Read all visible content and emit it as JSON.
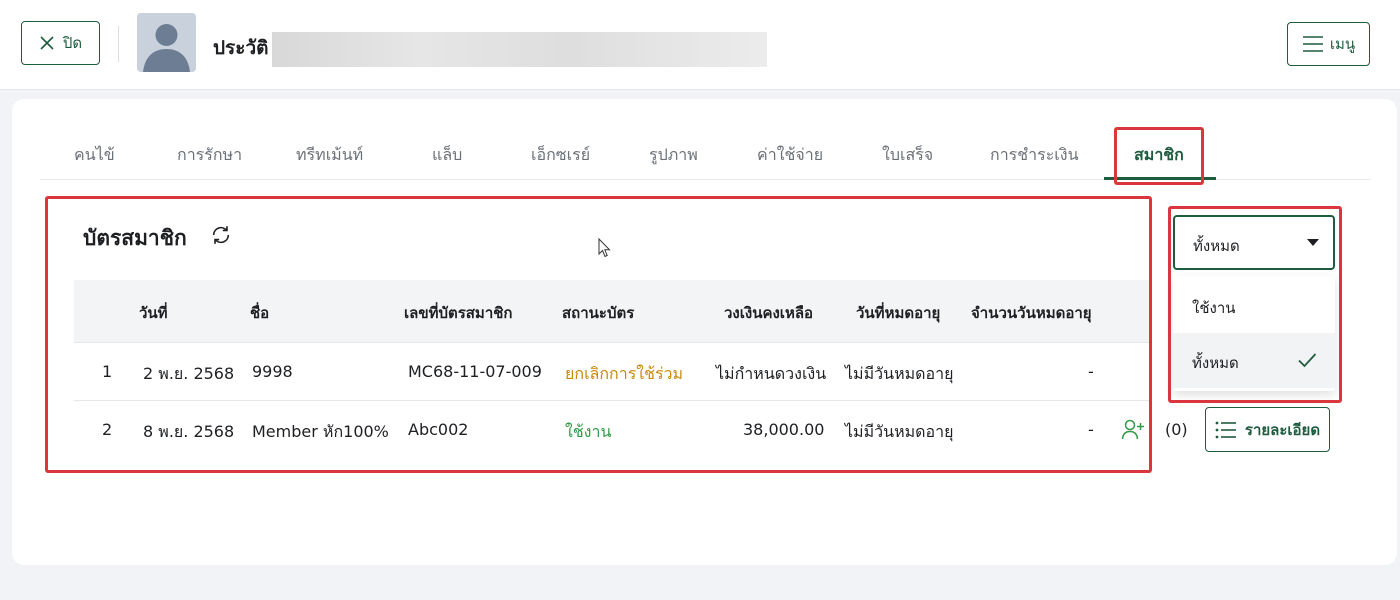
{
  "header": {
    "close_label": "ปิด",
    "title": "ประวัติ",
    "menu_label": "เมนู"
  },
  "tabs": [
    {
      "label": "คนไข้"
    },
    {
      "label": "การรักษา"
    },
    {
      "label": "ทรีทเม้นท์"
    },
    {
      "label": "แล็บ"
    },
    {
      "label": "เอ็กซเรย์"
    },
    {
      "label": "รูปภาพ"
    },
    {
      "label": "ค่าใช้จ่าย"
    },
    {
      "label": "ใบเสร็จ"
    },
    {
      "label": "การชำระเงิน"
    },
    {
      "label": "สมาชิก",
      "active": true
    }
  ],
  "section": {
    "title": "บัตรสมาชิก"
  },
  "table": {
    "columns": [
      "วันที่",
      "ชื่อ",
      "เลขที่บัตรสมาชิก",
      "สถานะบัตร",
      "วงเงินคงเหลือ",
      "วันที่หมดอายุ",
      "จำนวนวันหมดอายุ"
    ],
    "rows": [
      {
        "no": "1",
        "date": "2 พ.ย. 2568",
        "name": "9998",
        "card_no": "MC68-11-07-009",
        "status": "ยกเลิกการใช้ร่วม",
        "balance": "ไม่กำหนดวงเงิน",
        "expiry": "ไม่มีวันหมดอายุ",
        "days": "-"
      },
      {
        "no": "2",
        "date": "8 พ.ย. 2568",
        "name": "Member หัก100%",
        "card_no": "Abc002",
        "status": "ใช้งาน",
        "balance": "38,000.00",
        "expiry": "ไม่มีวันหมดอายุ",
        "days": "-",
        "member_count": "(0)",
        "detail_label": "รายละเอียด"
      }
    ]
  },
  "filter": {
    "selected": "ทั้งหมด",
    "options": [
      {
        "label": "ใช้งาน"
      },
      {
        "label": "ทั้งหมด",
        "selected": true
      }
    ]
  },
  "colors": {
    "primary": "#1f5c3f",
    "status_cancel": "#c88a0c",
    "status_active": "#2f9a47",
    "highlight": "#d9363e"
  }
}
